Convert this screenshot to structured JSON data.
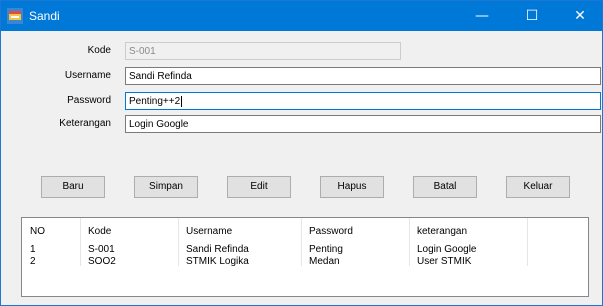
{
  "window": {
    "title": "Sandi"
  },
  "titlebar_controls": {
    "minimize": "—",
    "maximize": "☐",
    "close": "✕"
  },
  "form": {
    "kode_label": "Kode",
    "kode_value": "S-001",
    "username_label": "Username",
    "username_value": "Sandi Refinda",
    "password_label": "Password",
    "password_value": "Penting++2",
    "keterangan_label": "Keterangan",
    "keterangan_value": "Login Google"
  },
  "buttons": {
    "baru": "Baru",
    "simpan": "Simpan",
    "edit": "Edit",
    "hapus": "Hapus",
    "batal": "Batal",
    "keluar": "Keluar"
  },
  "list": {
    "columns": [
      "NO",
      "Kode",
      "Username",
      "Password",
      "keterangan"
    ],
    "rows": [
      [
        "1",
        "S-001",
        "Sandi Refinda",
        "Penting",
        "Login Google"
      ],
      [
        "2",
        "SOO2",
        "STMIK Logika",
        "Medan",
        "User STMIK"
      ]
    ]
  },
  "colors": {
    "titlebar": "#0078d7",
    "window_bg": "#f0f0f0",
    "focus_border": "#0078d7"
  }
}
